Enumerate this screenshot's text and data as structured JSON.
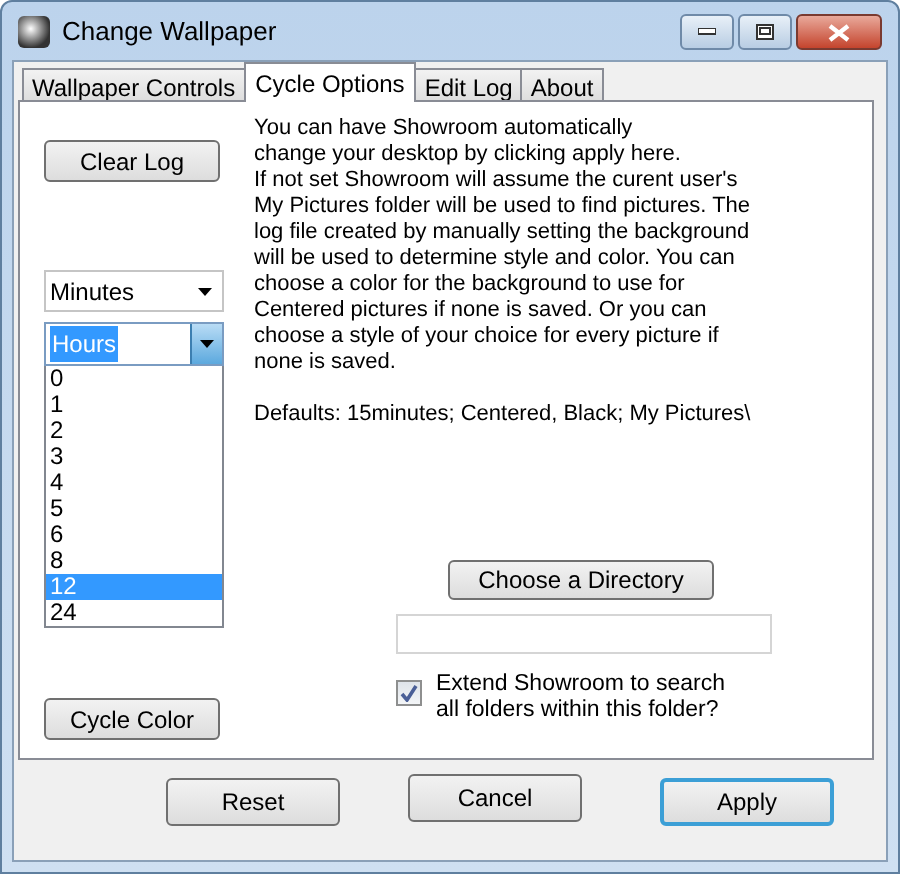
{
  "window": {
    "title": "Change Wallpaper"
  },
  "tabs": [
    {
      "label": "Wallpaper Controls",
      "selected": false
    },
    {
      "label": "Cycle Options",
      "selected": true
    },
    {
      "label": "Edit Log",
      "selected": false
    },
    {
      "label": "About",
      "selected": false
    }
  ],
  "clear_log_button": "Clear Log",
  "unit_dropdown": {
    "value": "Minutes"
  },
  "hours_combo": {
    "value": "Hours",
    "expanded": true,
    "options": [
      {
        "label": "0",
        "selected": false
      },
      {
        "label": "1",
        "selected": false
      },
      {
        "label": "2",
        "selected": false
      },
      {
        "label": "3",
        "selected": false
      },
      {
        "label": "4",
        "selected": false
      },
      {
        "label": "5",
        "selected": false
      },
      {
        "label": "6",
        "selected": false
      },
      {
        "label": "8",
        "selected": false
      },
      {
        "label": "12",
        "selected": true
      },
      {
        "label": "24",
        "selected": false
      }
    ]
  },
  "cycle_color_button": "Cycle Color",
  "description": "You can have Showroom automatically\nchange your desktop by clicking apply here.\nIf not set Showroom will assume the curent user's\nMy Pictures folder will be used to find pictures.  The\nlog file created by manually setting the background\nwill be used to determine style and color.  You can\nchoose a color for the background to use for\nCentered pictures if none is saved.  Or you can\nchoose a style of your choice for every picture if\nnone is saved.",
  "defaults": "Defaults: 15minutes; Centered, Black; My Pictures\\",
  "choose_directory_button": "Choose a Directory",
  "extend_checkbox": {
    "label": "Extend Showroom to search\nall folders within this folder?",
    "checked": true
  },
  "footer_buttons": [
    {
      "label": "Reset",
      "default": false
    },
    {
      "label": "Cancel",
      "default": false
    },
    {
      "label": "Apply",
      "default": true
    }
  ]
}
